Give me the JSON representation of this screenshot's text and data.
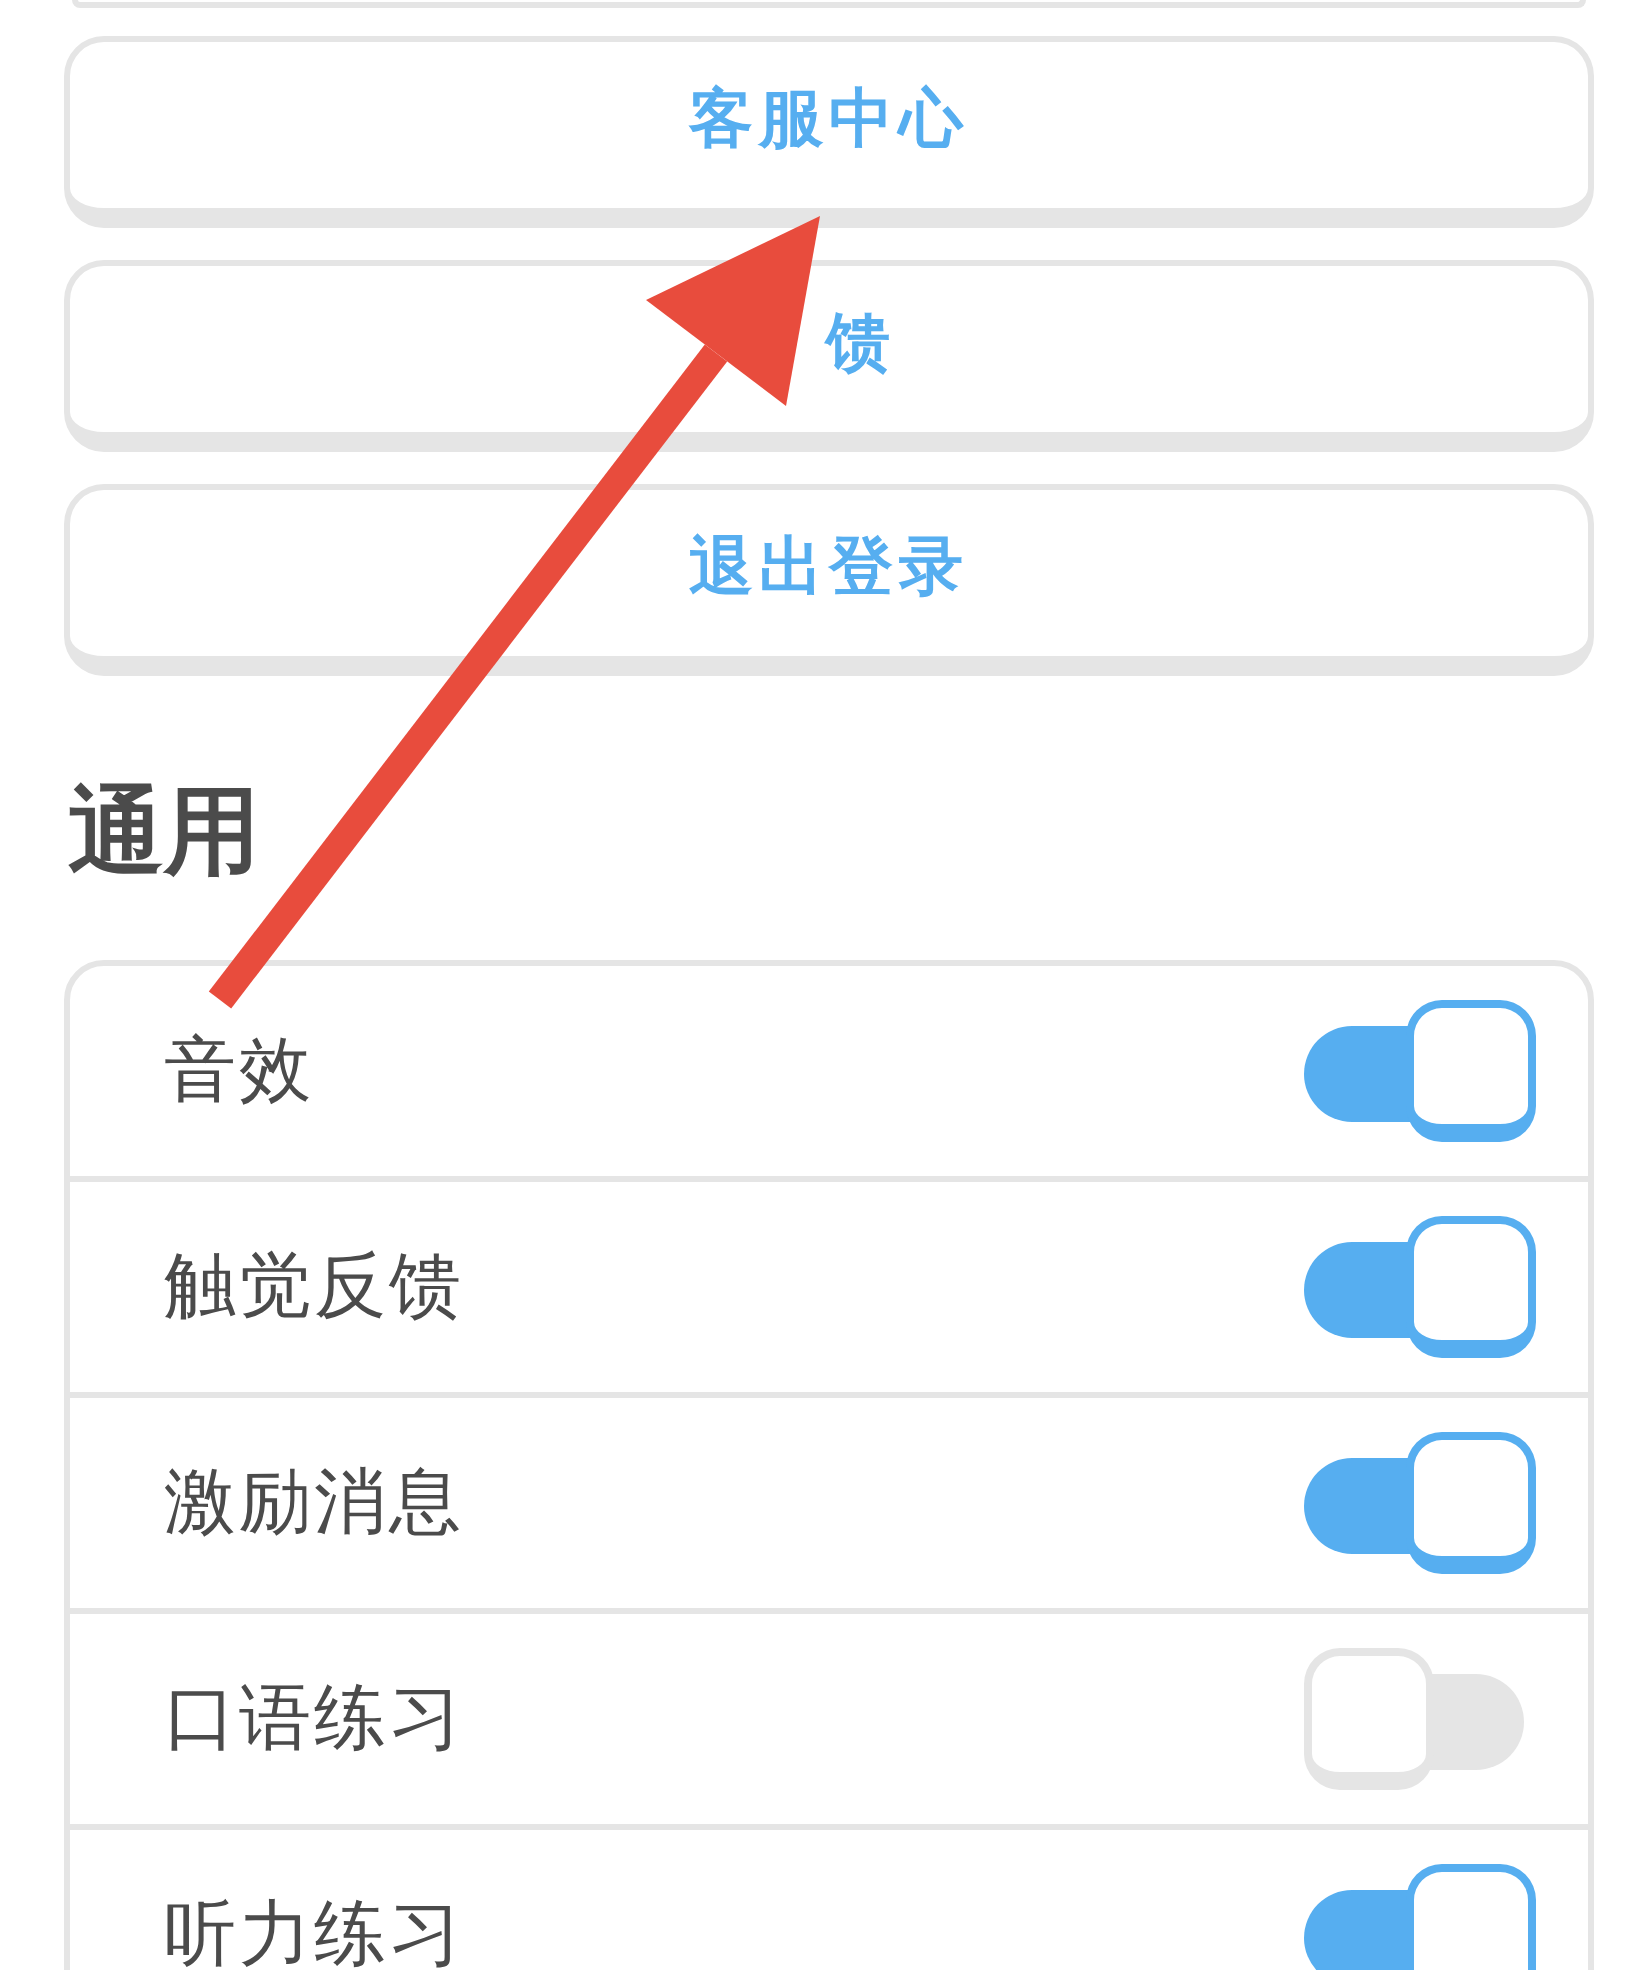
{
  "buttons": [
    {
      "label": "客服中心",
      "covered": false
    },
    {
      "label": "馈",
      "covered": true
    },
    {
      "label": "退出登录",
      "covered": false
    }
  ],
  "general": {
    "title": "通用",
    "settings": [
      {
        "label": "音效",
        "on": true
      },
      {
        "label": "触觉反馈",
        "on": true
      },
      {
        "label": "激励消息",
        "on": true
      },
      {
        "label": "口语练习",
        "on": false
      },
      {
        "label": "听力练习",
        "on": true
      }
    ]
  }
}
